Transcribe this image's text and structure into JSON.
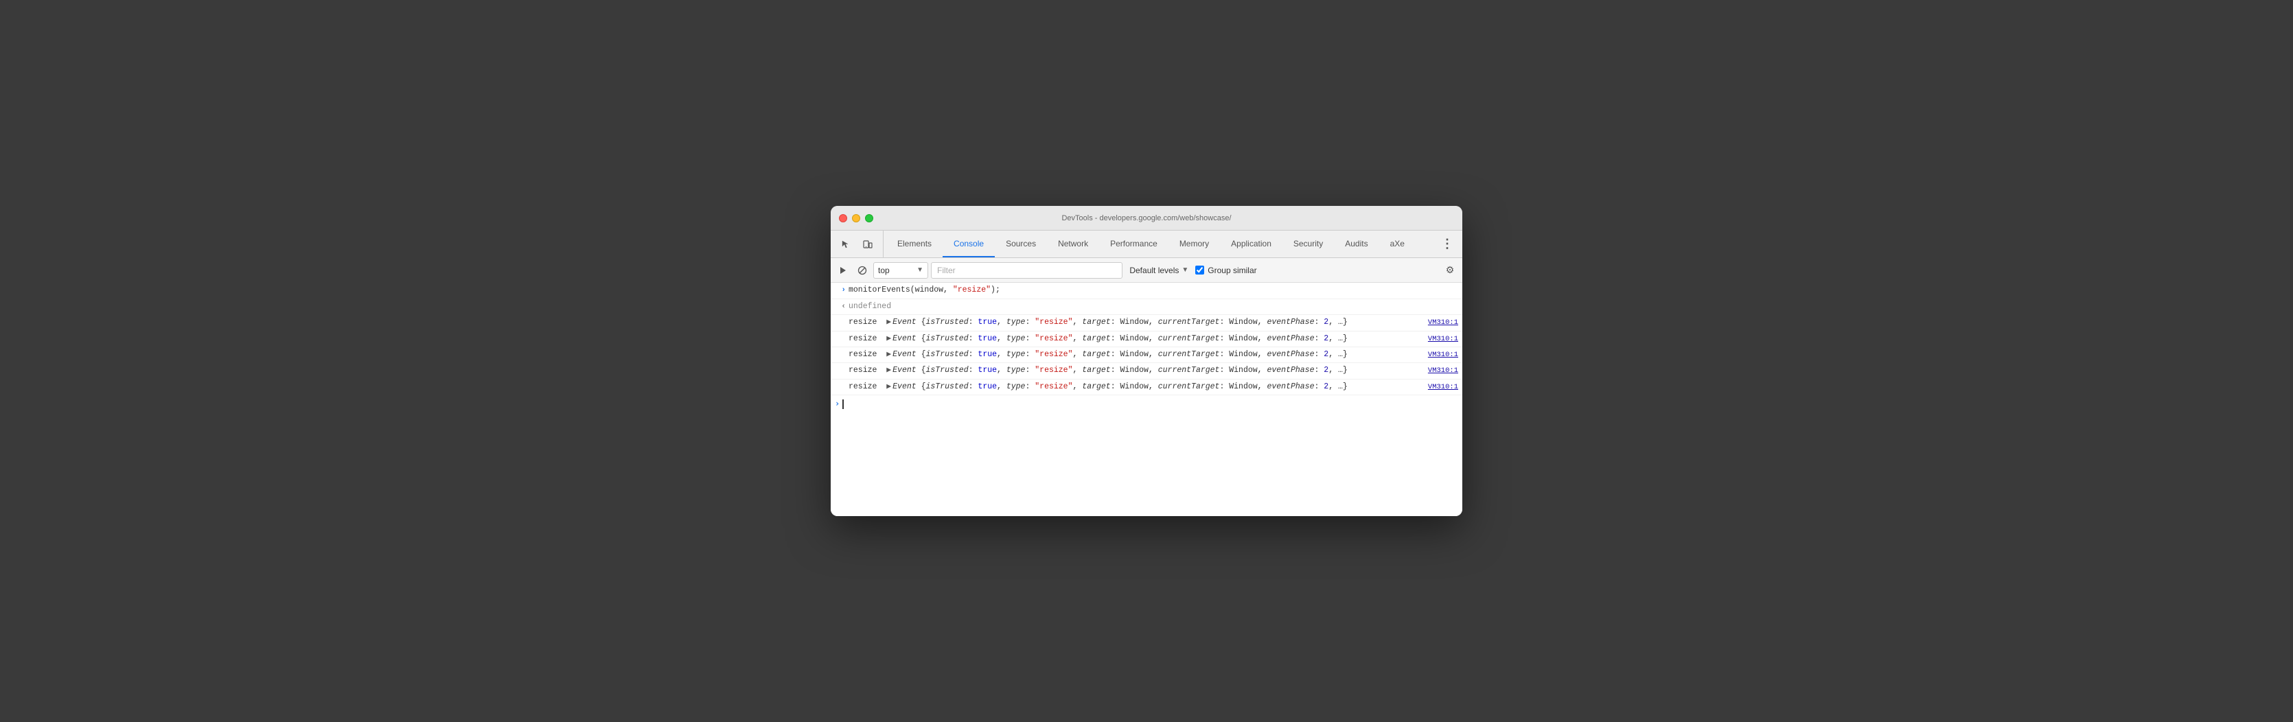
{
  "titleBar": {
    "title": "DevTools - developers.google.com/web/showcase/"
  },
  "tabs": [
    {
      "id": "elements",
      "label": "Elements",
      "active": false
    },
    {
      "id": "console",
      "label": "Console",
      "active": true
    },
    {
      "id": "sources",
      "label": "Sources",
      "active": false
    },
    {
      "id": "network",
      "label": "Network",
      "active": false
    },
    {
      "id": "performance",
      "label": "Performance",
      "active": false
    },
    {
      "id": "memory",
      "label": "Memory",
      "active": false
    },
    {
      "id": "application",
      "label": "Application",
      "active": false
    },
    {
      "id": "security",
      "label": "Security",
      "active": false
    },
    {
      "id": "audits",
      "label": "Audits",
      "active": false
    },
    {
      "id": "axe",
      "label": "aXe",
      "active": false
    }
  ],
  "toolbar": {
    "contextSelector": "top",
    "filterPlaceholder": "Filter",
    "levelsLabel": "Default levels",
    "groupSimilarLabel": "Group similar",
    "groupSimilarChecked": true
  },
  "console": {
    "command": {
      "prefix": ">",
      "text": "monitorEvents(window, \"resize\");"
    },
    "undefinedLine": {
      "prefix": "<",
      "text": "undefined"
    },
    "events": [
      {
        "label": "resize",
        "source": "VM310:1"
      },
      {
        "label": "resize",
        "source": "VM310:1"
      },
      {
        "label": "resize",
        "source": "VM310:1"
      },
      {
        "label": "resize",
        "source": "VM310:1"
      },
      {
        "label": "resize",
        "source": "VM310:1"
      }
    ],
    "eventDetails": "{isTrusted: true, type: \"resize\", target: Window, currentTarget: Window, eventPhase: 2, …}",
    "promptSymbol": ">"
  }
}
